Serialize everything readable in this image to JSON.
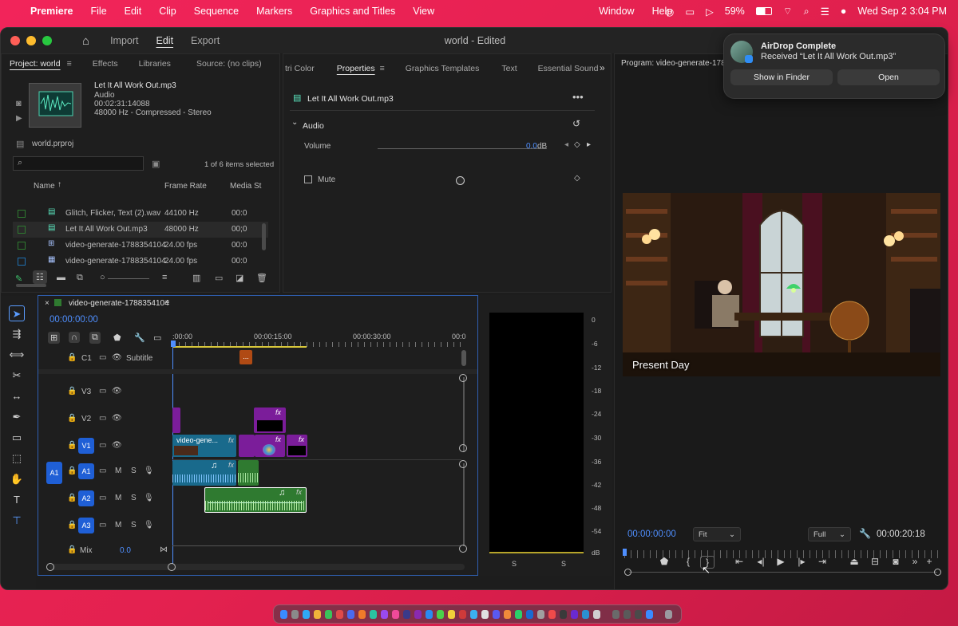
{
  "menubar": {
    "app": "Premiere",
    "items": [
      "File",
      "Edit",
      "Clip",
      "Sequence",
      "Markers",
      "Graphics and Titles",
      "View",
      "Window",
      "Help"
    ],
    "battery": "59%",
    "datetime": "Wed Sep 2  3:04 PM"
  },
  "window": {
    "title": "world - Edited",
    "workspaces": [
      "Import",
      "Edit",
      "Export"
    ]
  },
  "project": {
    "tabs": [
      "Project: world",
      "Effects",
      "Libraries",
      "Source: (no clips)"
    ],
    "preview": {
      "name": "Let It All Work Out.mp3",
      "type": "Audio",
      "duration": "00:02:31:14088",
      "format": "48000 Hz - Compressed - Stereo"
    },
    "file": "world.prproj",
    "search_placeholder": "",
    "selection_info": "1 of 6 items selected",
    "columns": [
      "Name",
      "Frame Rate",
      "Media St"
    ],
    "rows": [
      {
        "name": "Glitch, Flicker, Text (2).wav",
        "rate": "44100 Hz",
        "media": "00:0"
      },
      {
        "name": "Let It All Work Out.mp3",
        "rate": "48000 Hz",
        "media": "00;0"
      },
      {
        "name": "video-generate-1788354104",
        "rate": "24.00 fps",
        "media": "00:0"
      },
      {
        "name": "video-generate-1788354104.",
        "rate": "24.00 fps",
        "media": "00:0"
      }
    ]
  },
  "properties": {
    "tabs": [
      "tri Color",
      "Properties",
      "Graphics Templates",
      "Text",
      "Essential Sound"
    ],
    "clip_name": "Let It All Work Out.mp3",
    "section": "Audio",
    "volume_label": "Volume",
    "volume_value": "0.0",
    "volume_unit": "dB",
    "mute_label": "Mute"
  },
  "timeline": {
    "sequence": "video-generate-1788354104",
    "timecode": "00:00:00:00",
    "ruler": [
      ":00:00",
      "00:00:15:00",
      "00:00:30:00",
      "00:0"
    ],
    "tracks": [
      {
        "id": "C1",
        "name": "Subtitle"
      },
      {
        "id": "V3"
      },
      {
        "id": "V2"
      },
      {
        "id": "V1"
      },
      {
        "id": "A1",
        "src": "A1"
      },
      {
        "id": "A2"
      },
      {
        "id": "A3"
      }
    ],
    "mix_label": "Mix",
    "mix_value": "0.0",
    "clip_label": "video-gene...",
    "sub_clip": "..."
  },
  "meter": {
    "scale": [
      "0",
      "-6",
      "-12",
      "-18",
      "-24",
      "-30",
      "-36",
      "-42",
      "-48",
      "-54",
      "dB"
    ],
    "solo": [
      "S",
      "S"
    ]
  },
  "program": {
    "title": "Program: video-generate-17883",
    "overlay_text": "Present Day",
    "timecode": "00:00:00:00",
    "fit": "Fit",
    "resolution": "Full",
    "duration": "00:00:20:18"
  },
  "notification": {
    "title": "AirDrop Complete",
    "body": "Received “Let It All Work Out.mp3”",
    "btn_finder": "Show in Finder",
    "btn_open": "Open"
  },
  "colors": {
    "accent": "#4f8fff",
    "video_clip": "#7b1d9a",
    "audio_clip": "#2f7a30",
    "v1_clip": "#196a8c",
    "desktop": "#e8214f"
  }
}
